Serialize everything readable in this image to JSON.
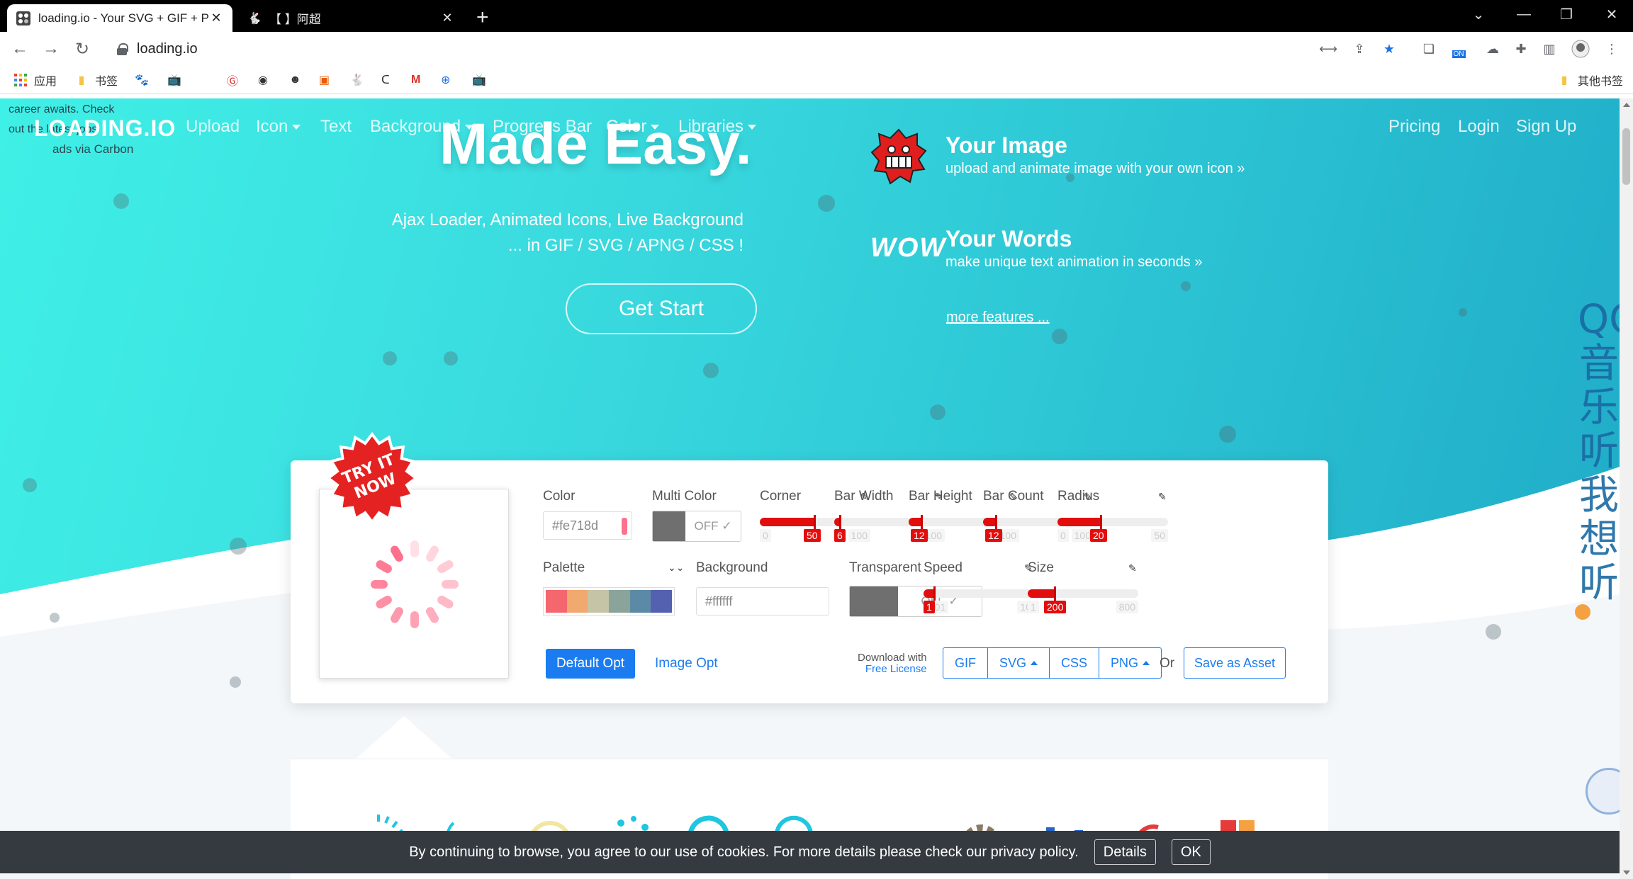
{
  "browser": {
    "tabs": [
      {
        "title": "loading.io - Your SVG + GIF + PNG Ajax Loading Icons",
        "active": true
      },
      {
        "title": "【           】阿超",
        "active": false
      }
    ],
    "url": "loading.io",
    "bookmarks": [
      "应用",
      "书签"
    ],
    "other_bookmarks": "其他书签",
    "ext_badge": "ON"
  },
  "carbon": {
    "line1": "career awaits. Check",
    "line2": "out the latest jobs",
    "via": "ads via Carbon"
  },
  "nav": {
    "logo": "LOADING.IO",
    "items": [
      "Upload",
      "Icon",
      "Text",
      "Background",
      "Progress Bar",
      "Color",
      "Libraries"
    ],
    "right": [
      "Pricing",
      "Login",
      "Sign Up"
    ]
  },
  "hero": {
    "title": "Made Easy.",
    "sub1": "Ajax Loader, Animated Icons, Live Background",
    "sub2": "... in GIF / SVG / APNG / CSS !",
    "cta": "Get Start"
  },
  "features": [
    {
      "title": "Your Image",
      "desc": "upload and animate image with your own icon »"
    },
    {
      "title": "Your Words",
      "desc": "make unique text animation in seconds »"
    }
  ],
  "wow_text": "WOW",
  "more_features": "more features ...",
  "side_text": "QQ音乐 听我想听",
  "badge": {
    "line1": "TRY IT",
    "line2": "NOW"
  },
  "controls": {
    "color": {
      "label": "Color",
      "value": "#fe718d"
    },
    "multi_color": {
      "label": "Multi Color",
      "value": "OFF ✓"
    },
    "palette": {
      "label": "Palette",
      "colors": [
        "#f5676f",
        "#f0a96f",
        "#c6c4a6",
        "#8aa49b",
        "#5c8aa6",
        "#5361b0"
      ]
    },
    "background": {
      "label": "Background",
      "placeholder": "#ffffff"
    },
    "transparent": {
      "label": "Transparent",
      "value": "OFF ✓"
    },
    "sliders": [
      {
        "label": "Corner",
        "min": "0",
        "max": "100",
        "value": 50
      },
      {
        "label": "Bar Width",
        "min": "",
        "max": "100",
        "value": 6
      },
      {
        "label": "Bar Height",
        "min": "",
        "max": "100",
        "value": 12
      },
      {
        "label": "Bar Count",
        "min": "",
        "max": "100",
        "value": 12
      },
      {
        "label": "Radius",
        "min": "0",
        "max": "50",
        "value": 20
      },
      {
        "label": "Speed",
        "min": "0.01",
        "max": "10",
        "value": 1
      },
      {
        "label": "Size",
        "min": "1",
        "max": "800",
        "value": 200
      }
    ],
    "default_opt": "Default Opt",
    "image_opt": "Image Opt",
    "download_with": "Download with",
    "free_license": "Free License",
    "formats": [
      "GIF",
      "SVG",
      "CSS",
      "PNG"
    ],
    "or": "Or",
    "save_asset": "Save as Asset"
  },
  "cookie": {
    "text": "By continuing to browse, you agree to our use of cookies. For more details please check our privacy policy.",
    "details": "Details",
    "ok": "OK"
  },
  "colors": {
    "accent": "#1a7cf0",
    "slider": "#e20d0d",
    "spinner": "#fe718d",
    "cookie_bg": "#343a40"
  }
}
